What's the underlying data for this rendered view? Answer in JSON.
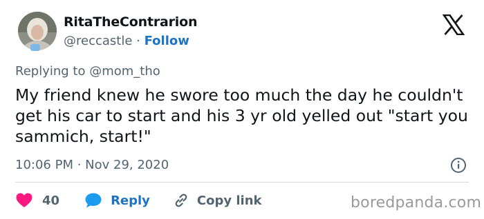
{
  "author": {
    "display_name": "RitaTheContrarion",
    "handle": "@reccastle",
    "separator": " · ",
    "follow_label": "Follow"
  },
  "header": {
    "logo_icon": "x-logo-icon"
  },
  "tweet": {
    "reply_prefix": "Replying to ",
    "reply_to": "@mom_tho",
    "text": "My friend knew he swore too much the day he couldn't get his car to start and his 3 yr old yelled out \"start you sammich, start!\"",
    "timestamp": "10:06 PM · Nov 29, 2020"
  },
  "actions": {
    "like_count": "40",
    "reply_label": "Reply",
    "copy_link_label": "Copy link"
  },
  "watermark": "boredpanda.com",
  "colors": {
    "accent": "#1d74c2",
    "like": "#f91880",
    "muted": "#536471",
    "text": "#0f1419",
    "divider": "#cfd9de"
  }
}
